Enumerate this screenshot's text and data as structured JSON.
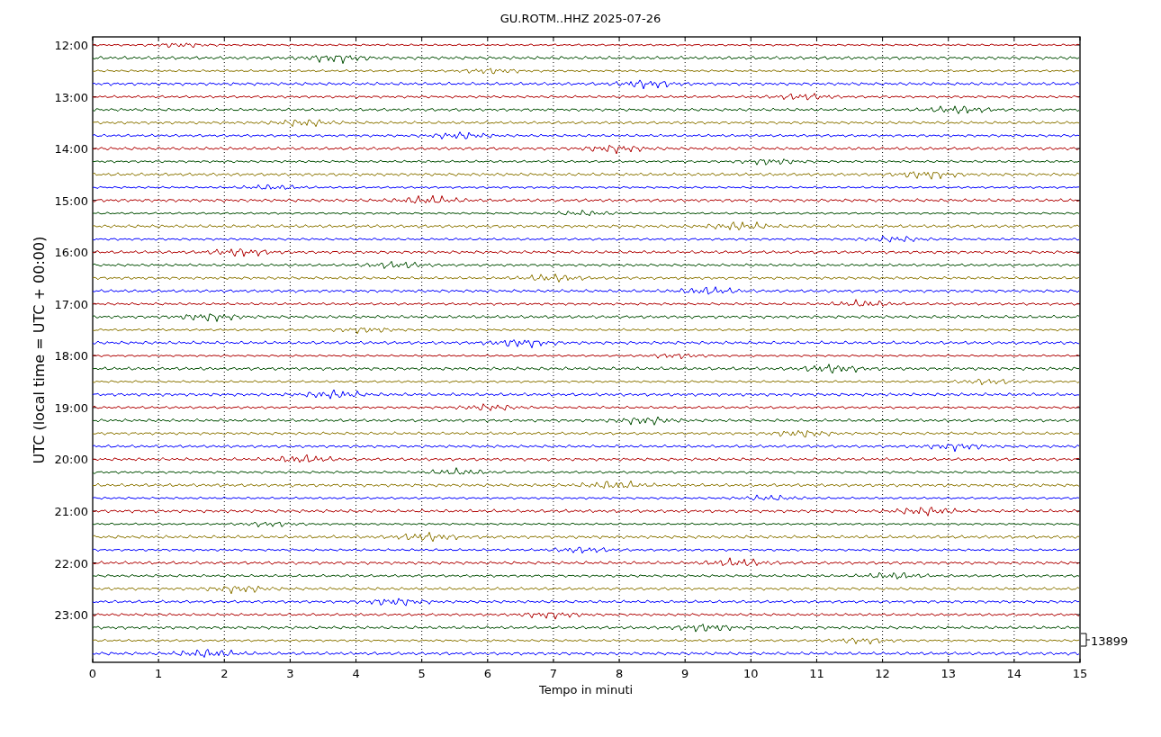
{
  "title": "GU.ROTM..HHZ 2025-07-26",
  "y_axis": {
    "label": "UTC (local time = UTC + 00:00)",
    "hours": [
      "12:00",
      "13:00",
      "14:00",
      "15:00",
      "16:00",
      "17:00",
      "18:00",
      "19:00",
      "20:00",
      "21:00",
      "22:00",
      "23:00"
    ]
  },
  "x_axis": {
    "label": "Tempo in minuti",
    "ticks": [
      "0",
      "1",
      "2",
      "3",
      "4",
      "5",
      "6",
      "7",
      "8",
      "9",
      "10",
      "11",
      "12",
      "13",
      "14",
      "15"
    ]
  },
  "traces": [
    {
      "color": "#b00000"
    },
    {
      "color": "#004d00"
    },
    {
      "color": "#8b7500"
    },
    {
      "color": "#0000ff"
    }
  ],
  "scale_label": "13899"
}
